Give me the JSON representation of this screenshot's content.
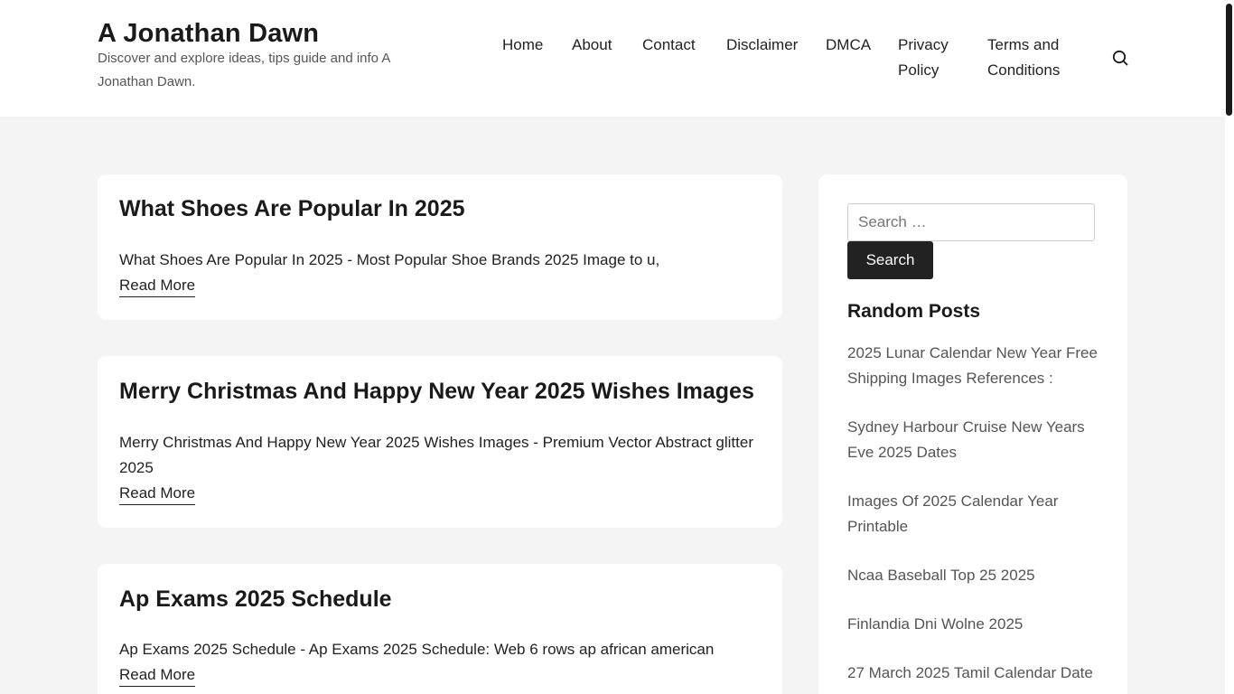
{
  "site": {
    "title": "A Jonathan Dawn",
    "tagline": "Discover and explore ideas, tips guide and info A Jonathan Dawn."
  },
  "nav": {
    "items": [
      {
        "label": "Home"
      },
      {
        "label": "About"
      },
      {
        "label": "Contact"
      },
      {
        "label": "Disclaimer"
      },
      {
        "label": "DMCA"
      },
      {
        "label": "Privacy Policy"
      },
      {
        "label": "Terms and Conditions"
      }
    ],
    "search_icon": "search-icon"
  },
  "posts": [
    {
      "title": "What Shoes Are Popular In 2025",
      "excerpt": "What Shoes Are Popular In 2025 - Most Popular Shoe Brands 2025 Image to u,",
      "read_more": "Read More"
    },
    {
      "title": "Merry Christmas And Happy New Year 2025 Wishes Images",
      "excerpt": "Merry Christmas And Happy New Year 2025 Wishes Images - Premium Vector Abstract glitter 2025",
      "read_more": "Read More"
    },
    {
      "title": "Ap Exams 2025 Schedule",
      "excerpt": "Ap Exams 2025 Schedule - Ap Exams 2025 Schedule: Web 6 rows ap african american",
      "read_more": "Read More"
    }
  ],
  "sidebar": {
    "search_placeholder": "Search …",
    "search_button": "Search",
    "random_posts_title": "Random Posts",
    "random_posts": [
      "2025 Lunar Calendar New Year Free Shipping Images References :",
      "Sydney Harbour Cruise New Years Eve 2025 Dates",
      "Images Of 2025 Calendar Year Printable",
      "Ncaa Baseball Top 25 2025",
      "Finlandia Dni Wolne 2025",
      "27 March 2025 Tamil Calendar Date"
    ]
  }
}
